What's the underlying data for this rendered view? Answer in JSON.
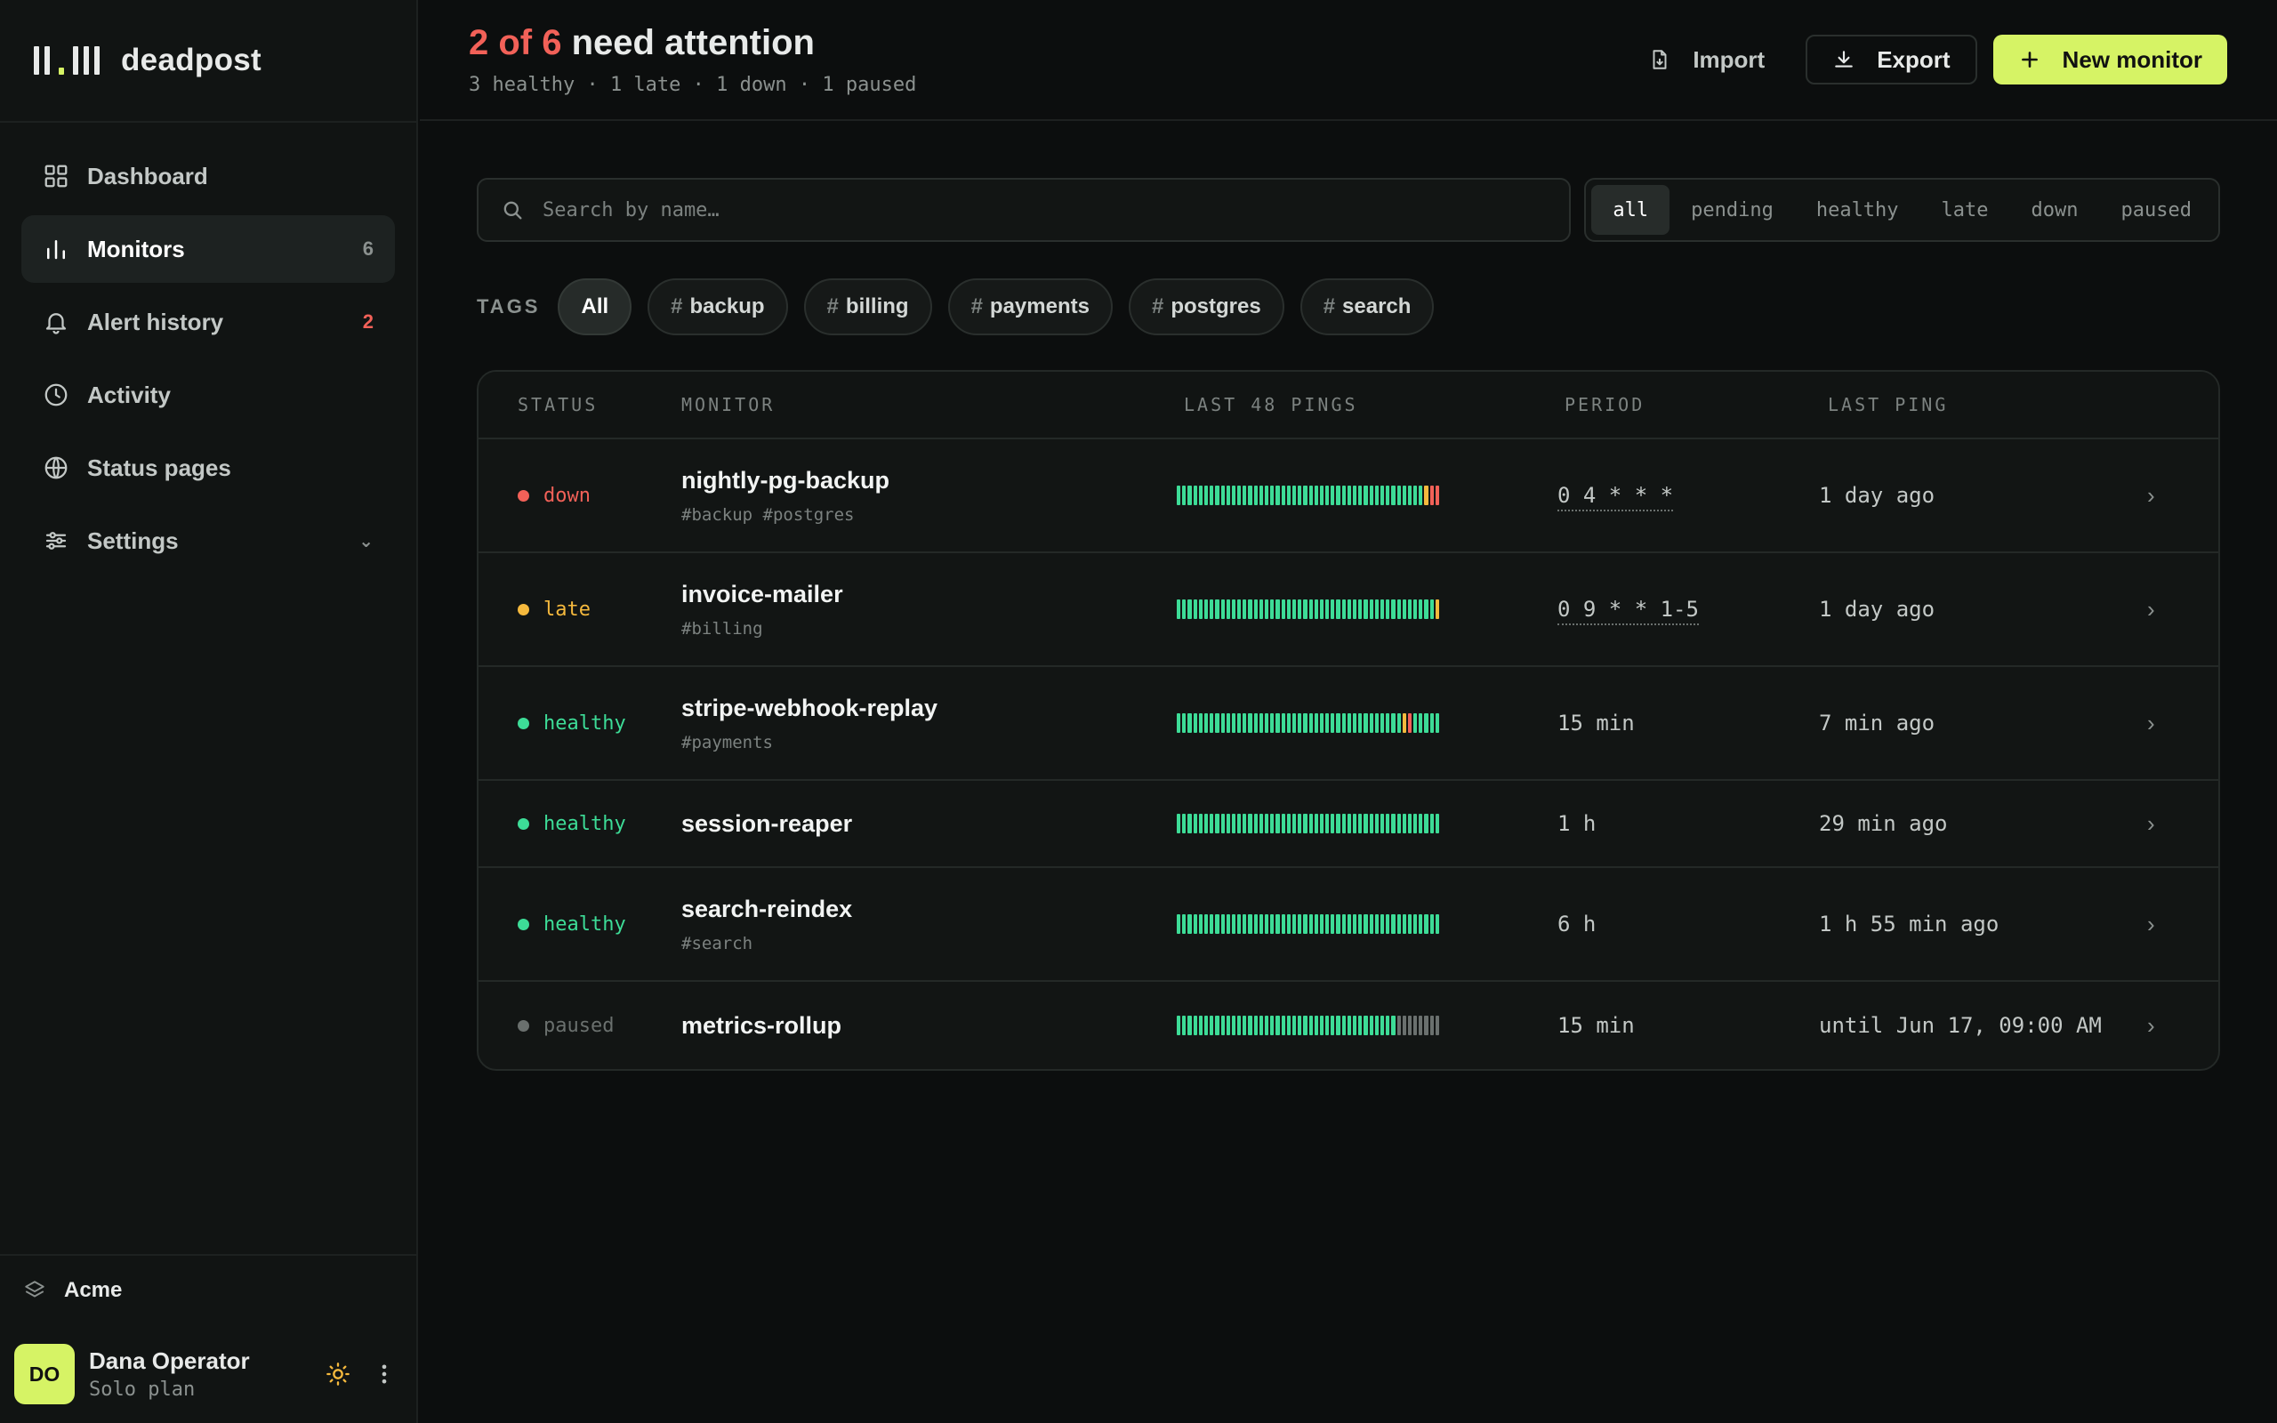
{
  "brand": {
    "name": "deadpost"
  },
  "nav": [
    {
      "label": "Dashboard",
      "icon": "grid-icon",
      "count": ""
    },
    {
      "label": "Monitors",
      "icon": "bar-chart-icon",
      "count": "6"
    },
    {
      "label": "Alert history",
      "icon": "bell-icon",
      "count": "2"
    },
    {
      "label": "Activity",
      "icon": "clock-icon",
      "count": ""
    },
    {
      "label": "Status pages",
      "icon": "globe-icon",
      "count": ""
    },
    {
      "label": "Settings",
      "icon": "sliders-icon",
      "count": "⌄"
    }
  ],
  "org": {
    "name": "Acme"
  },
  "user": {
    "initials": "DO",
    "name": "Dana Operator",
    "plan": "Solo plan"
  },
  "header": {
    "title_count": "2 of 6",
    "title_rest": " need attention",
    "subtitle": "3 healthy · 1 late · 1 down · 1 paused",
    "import_label": "Import",
    "export_label": "Export",
    "new_label": "New monitor"
  },
  "search": {
    "placeholder": "Search by name…"
  },
  "filters": [
    "all",
    "pending",
    "healthy",
    "late",
    "down",
    "paused"
  ],
  "tags": {
    "label": "TAGS",
    "items": [
      "All",
      "backup",
      "billing",
      "payments",
      "postgres",
      "search"
    ]
  },
  "table": {
    "headers": {
      "status": "STATUS",
      "monitor": "MONITOR",
      "pings": "LAST 48 PINGS",
      "period": "PERIOD",
      "last": "LAST PING"
    },
    "rows": [
      {
        "status": "down",
        "name": "nightly-pg-backup",
        "tags": "#backup #postgres",
        "period": "0 4 * * *",
        "period_is_cron": true,
        "last": "1 day ago",
        "pings": "gggggggggggggggggggggggggggggggggggggggggggggyrr"
      },
      {
        "status": "late",
        "name": "invoice-mailer",
        "tags": "#billing",
        "period": "0 9 * * 1-5",
        "period_is_cron": true,
        "last": "1 day ago",
        "pings": "gggggggggggggggggggggggggggggggggggggggggggggggy"
      },
      {
        "status": "healthy",
        "name": "stripe-webhook-replay",
        "tags": "#payments",
        "period": "15 min",
        "period_is_cron": false,
        "last": "7 min ago",
        "pings": "gggggggggggggggggggggggggggggggggggggggggyrgggggg"
      },
      {
        "status": "healthy",
        "name": "session-reaper",
        "tags": "",
        "period": "1 h",
        "period_is_cron": false,
        "last": "29 min ago",
        "pings": "gggggggggggggggggggggggggggggggggggggggggggggggg"
      },
      {
        "status": "healthy",
        "name": "search-reindex",
        "tags": "#search",
        "period": "6 h",
        "period_is_cron": false,
        "last": "1 h 55 min ago",
        "pings": "gggggggggggggggggggggggggggggggggggggggggggggggg"
      },
      {
        "status": "paused",
        "name": "metrics-rollup",
        "tags": "",
        "period": "15 min",
        "period_is_cron": false,
        "last": "until Jun 17, 09:00 AM",
        "pings": "ggggggggggggggggggggggggggggggggggggggggxxxxxxxx"
      }
    ]
  },
  "colors": {
    "accent": "#d6f365",
    "down": "#f26158",
    "late": "#f5b93d",
    "healthy": "#3ddc97",
    "paused": "#6a706e"
  }
}
